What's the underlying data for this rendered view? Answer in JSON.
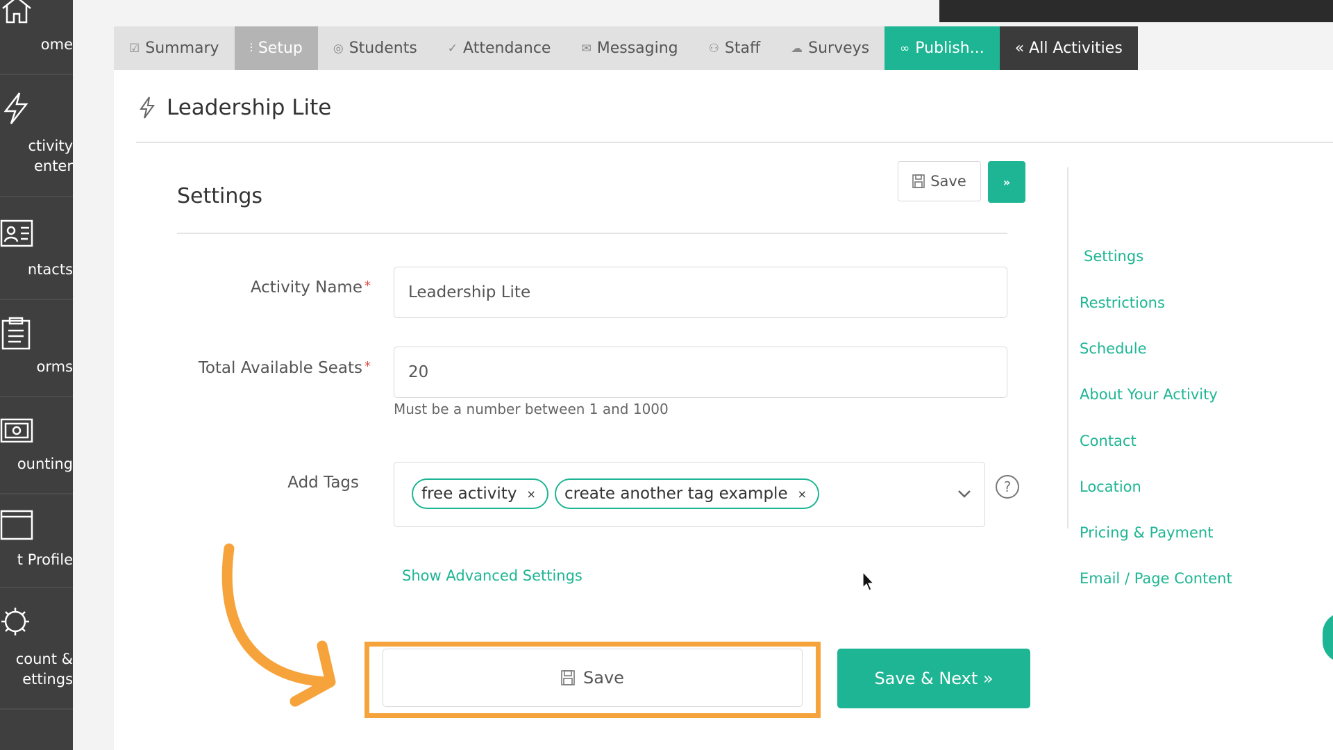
{
  "leftnav": {
    "items": [
      {
        "label": "ome",
        "icon": "home-icon"
      },
      {
        "label": "ctivity\nenter",
        "icon": "lightning-icon"
      },
      {
        "label": "ntacts",
        "icon": "contacts-card-icon"
      },
      {
        "label": "orms",
        "icon": "clipboard-icon"
      },
      {
        "label": "ounting",
        "icon": "money-icon"
      },
      {
        "label": "t Profile",
        "icon": "browser-window-icon"
      },
      {
        "label": "count &\nettings",
        "icon": "gear-icon"
      }
    ]
  },
  "tabs": [
    {
      "label": "Summary",
      "icon": "☑"
    },
    {
      "label": "Setup",
      "icon": "⫶"
    },
    {
      "label": "Students",
      "icon": "◎"
    },
    {
      "label": "Attendance",
      "icon": "✓"
    },
    {
      "label": "Messaging",
      "icon": "✉"
    },
    {
      "label": "Staff",
      "icon": "⚇"
    },
    {
      "label": "Surveys",
      "icon": "☁"
    },
    {
      "label": "Publish...",
      "icon": "🔗"
    },
    {
      "label": "« All Activities",
      "icon": ""
    }
  ],
  "activity": {
    "title": "Leadership Lite"
  },
  "settings": {
    "title": "Settings",
    "save_label": "Save",
    "next_label": "»",
    "activity_name": {
      "label": "Activity Name",
      "value": "Leadership Lite"
    },
    "total_seats": {
      "label": "Total Available Seats",
      "value": "20",
      "help": "Must be a number between 1 and 1000"
    },
    "tags": {
      "label": "Add Tags",
      "items": [
        "free activity",
        "create another tag example"
      ],
      "remove": "×",
      "help_icon": "?"
    },
    "advanced_link": "Show Advanced Settings",
    "bottom_save_label": "Save",
    "save_next_label": "Save & Next »",
    "required_mark": "*"
  },
  "sidenav": [
    "Settings",
    "Restrictions",
    "Schedule",
    "About Your Activity",
    "Contact",
    "Location",
    "Pricing & Payment",
    "Email / Page Content"
  ],
  "colors": {
    "accent": "#1db593",
    "highlight": "#f6a33b",
    "nav_bg": "#3f3f3f",
    "dark_tab": "#3b3b3b"
  }
}
